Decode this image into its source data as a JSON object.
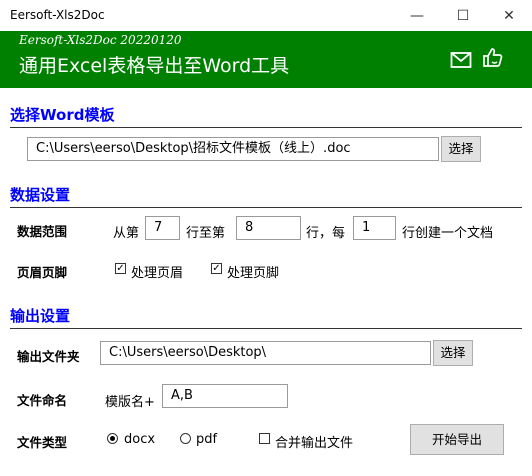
{
  "window": {
    "title": "Eersoft-Xls2Doc",
    "minimize_glyph": "—",
    "maximize_glyph": "☐",
    "close_glyph": "✕"
  },
  "banner": {
    "subtitle": "Eersoft-Xls2Doc 20220120",
    "title": "通用Excel表格导出至Word工具",
    "mail_icon": "mail-icon",
    "like_icon": "thumbs-up-icon"
  },
  "template_section": {
    "heading": "选择Word模板",
    "path_value": "C:\\Users\\eerso\\Desktop\\招标文件模板（线上）.doc",
    "browse_label": "选择"
  },
  "data_section": {
    "heading": "数据设置",
    "range_label": "数据范围",
    "from_label": "从第",
    "from_value": "7",
    "to_label": "行至第",
    "to_value": "8",
    "every_label": "行，每",
    "every_value": "1",
    "per_doc_label": "行创建一个文档",
    "header_footer_label": "页眉页脚",
    "process_header_label": "处理页眉",
    "process_header_checked": true,
    "process_footer_label": "处理页脚",
    "process_footer_checked": true
  },
  "output_section": {
    "heading": "输出设置",
    "folder_label": "输出文件夹",
    "folder_value": "C:\\Users\\eerso\\Desktop\\",
    "browse_label": "选择",
    "naming_label": "文件命名",
    "naming_prefix": "模版名+",
    "naming_value": "A,B",
    "type_label": "文件类型",
    "type_docx": "docx",
    "type_pdf": "pdf",
    "selected_type": "docx",
    "merge_label": "合并输出文件",
    "merge_checked": false,
    "start_label": "开始导出"
  }
}
